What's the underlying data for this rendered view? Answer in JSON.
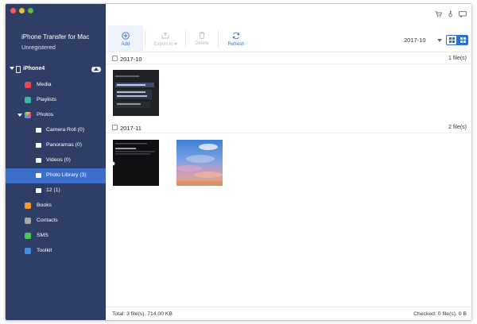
{
  "app": {
    "title": "iPhone Transfer for Mac",
    "status": "Unregistered"
  },
  "device": {
    "name": "iPhone4"
  },
  "sidebar": {
    "items": [
      {
        "label": "Media",
        "icon": "media-icon"
      },
      {
        "label": "Playlists",
        "icon": "playlist-icon"
      },
      {
        "label": "Photos",
        "icon": "photos-icon"
      },
      {
        "label": "Camera Roll (0)",
        "icon": "camera-icon"
      },
      {
        "label": "Panoramas (0)",
        "icon": "camera-icon"
      },
      {
        "label": "Videos (0)",
        "icon": "camera-icon"
      },
      {
        "label": "Photo Library (3)",
        "icon": "camera-icon"
      },
      {
        "label": "12 (1)",
        "icon": "camera-icon"
      },
      {
        "label": "Books",
        "icon": "books-icon"
      },
      {
        "label": "Contacts",
        "icon": "contacts-icon"
      },
      {
        "label": "SMS",
        "icon": "sms-icon"
      },
      {
        "label": "Toolkit",
        "icon": "toolkit-icon"
      }
    ],
    "selected": "Photo Library (3)"
  },
  "toolbar": {
    "add_label": "Add",
    "export_label": "Export to",
    "delete_label": "Delete",
    "refresh_label": "Refresh"
  },
  "filter": {
    "date_value": "2017-10"
  },
  "groups": [
    {
      "date": "2017-10",
      "count": "1 file(s)"
    },
    {
      "date": "2017-11",
      "count": "2 file(s)"
    }
  ],
  "status": {
    "total": "Total: 3 file(s), 714.00 KB",
    "checked": "Checked: 0 file(s), 0 B"
  },
  "colors": {
    "sidebar_bg": "#2e3e66",
    "selected_bg": "#3d6ec9",
    "accent": "#2f6fd0"
  }
}
